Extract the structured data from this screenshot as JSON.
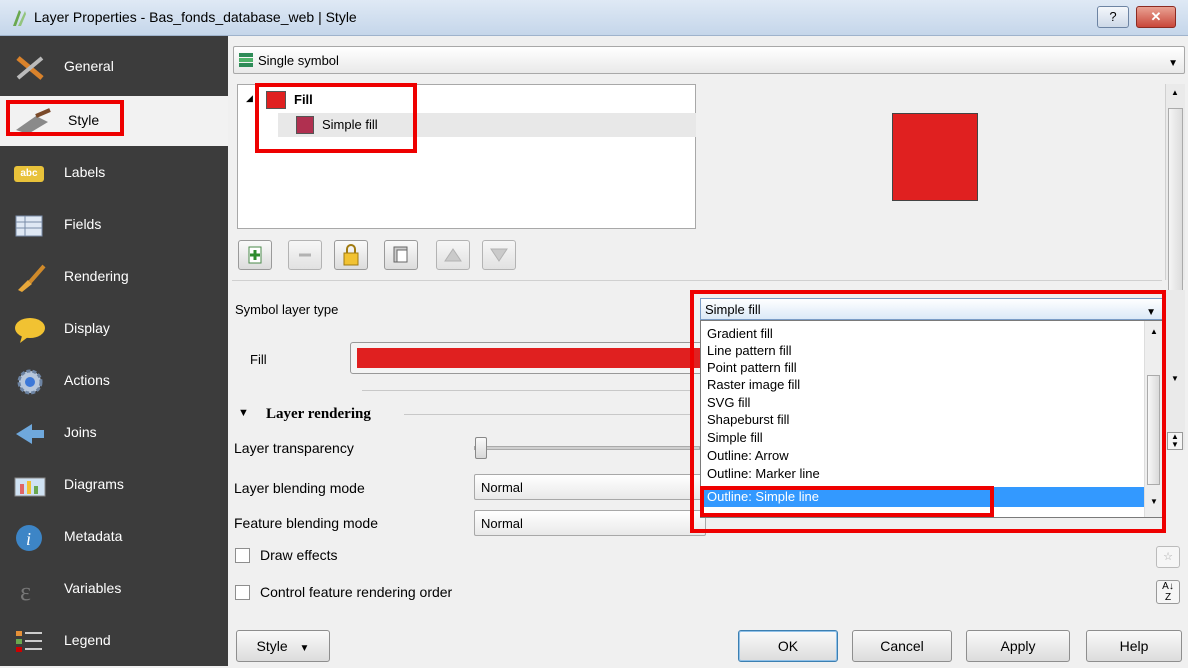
{
  "window": {
    "title": "Layer Properties - Bas_fonds_database_web | Style",
    "help_label": "?",
    "close_label": "✕"
  },
  "sidebar": {
    "items": [
      {
        "label": "General",
        "icon": "general-tools-icon"
      },
      {
        "label": "Style",
        "icon": "style-brush-icon"
      },
      {
        "label": "Labels",
        "icon": "labels-abc-icon"
      },
      {
        "label": "Fields",
        "icon": "fields-table-icon"
      },
      {
        "label": "Rendering",
        "icon": "rendering-brush-icon"
      },
      {
        "label": "Display",
        "icon": "display-speech-icon"
      },
      {
        "label": "Actions",
        "icon": "actions-gear-icon"
      },
      {
        "label": "Joins",
        "icon": "joins-arrow-icon"
      },
      {
        "label": "Diagrams",
        "icon": "diagrams-chart-icon"
      },
      {
        "label": "Metadata",
        "icon": "metadata-info-icon"
      },
      {
        "label": "Variables",
        "icon": "variables-epsilon-icon"
      },
      {
        "label": "Legend",
        "icon": "legend-list-icon"
      }
    ]
  },
  "renderer": {
    "selected": "Single symbol"
  },
  "symbol_tree": {
    "root": "Fill",
    "child": "Simple fill"
  },
  "colors": {
    "fill": "#e02020",
    "simple_fill_swatch": "#b03050",
    "highlight": "#3399ff",
    "annotation": "#ee0000"
  },
  "symbol_layer": {
    "type_label": "Symbol layer type",
    "type_value": "Simple fill",
    "fill_label": "Fill",
    "options": [
      "Gradient fill",
      "Line pattern fill",
      "Point pattern fill",
      "Raster image fill",
      "SVG fill",
      "Shapeburst fill",
      "Simple fill",
      "Outline: Arrow",
      "Outline: Marker line",
      "Outline: Simple line"
    ],
    "highlighted_option": "Outline: Simple line"
  },
  "layer_rendering": {
    "section_label": "Layer rendering",
    "transparency_label": "Layer transparency",
    "blending_label": "Layer blending mode",
    "blending_value": "Normal",
    "feature_blending_label": "Feature blending mode",
    "feature_blending_value": "Normal",
    "draw_effects_label": "Draw effects",
    "feature_order_label": "Control feature rendering order"
  },
  "footer": {
    "style_label": "Style",
    "ok_label": "OK",
    "cancel_label": "Cancel",
    "apply_label": "Apply",
    "help_label": "Help"
  }
}
